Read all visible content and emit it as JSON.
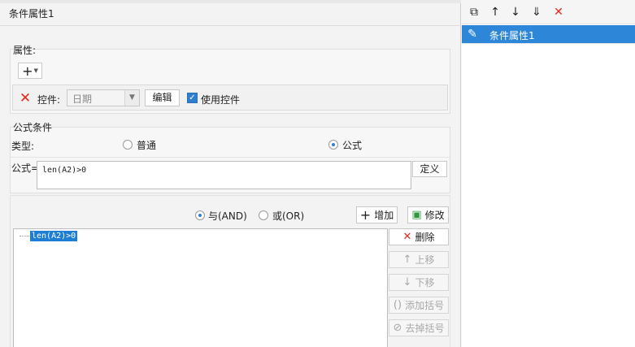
{
  "panel": {
    "title": "条件属性1"
  },
  "properties": {
    "label": "属性:",
    "add_symbol": "+",
    "widget_label": "控件:",
    "widget_value": "日期",
    "edit_label": "编辑",
    "use_widget_label": "使用控件",
    "use_widget_checked": true
  },
  "formula_condition": {
    "group_label": "公式条件",
    "type_label": "类型:",
    "normal_label": "普通",
    "formula_label": "公式",
    "selected_type": "公式",
    "formula_field_label": "公式=",
    "formula_value": "len(A2)>0",
    "define_label": "定义"
  },
  "logic": {
    "and_label": "与(AND)",
    "or_label": "或(OR)",
    "selected": "与(AND)",
    "add_label": "增加",
    "modify_label": "修改"
  },
  "condition_list": {
    "items": [
      "len(A2)>0"
    ],
    "delete_label": "删除",
    "move_up_label": "上移",
    "move_down_label": "下移",
    "add_paren_label": "添加括号",
    "remove_paren_label": "去掉括号"
  },
  "right_panel": {
    "items": [
      {
        "label": "条件属性1",
        "selected": true
      }
    ]
  },
  "colors": {
    "accent": "#2e86d8",
    "danger": "#e0281e"
  }
}
